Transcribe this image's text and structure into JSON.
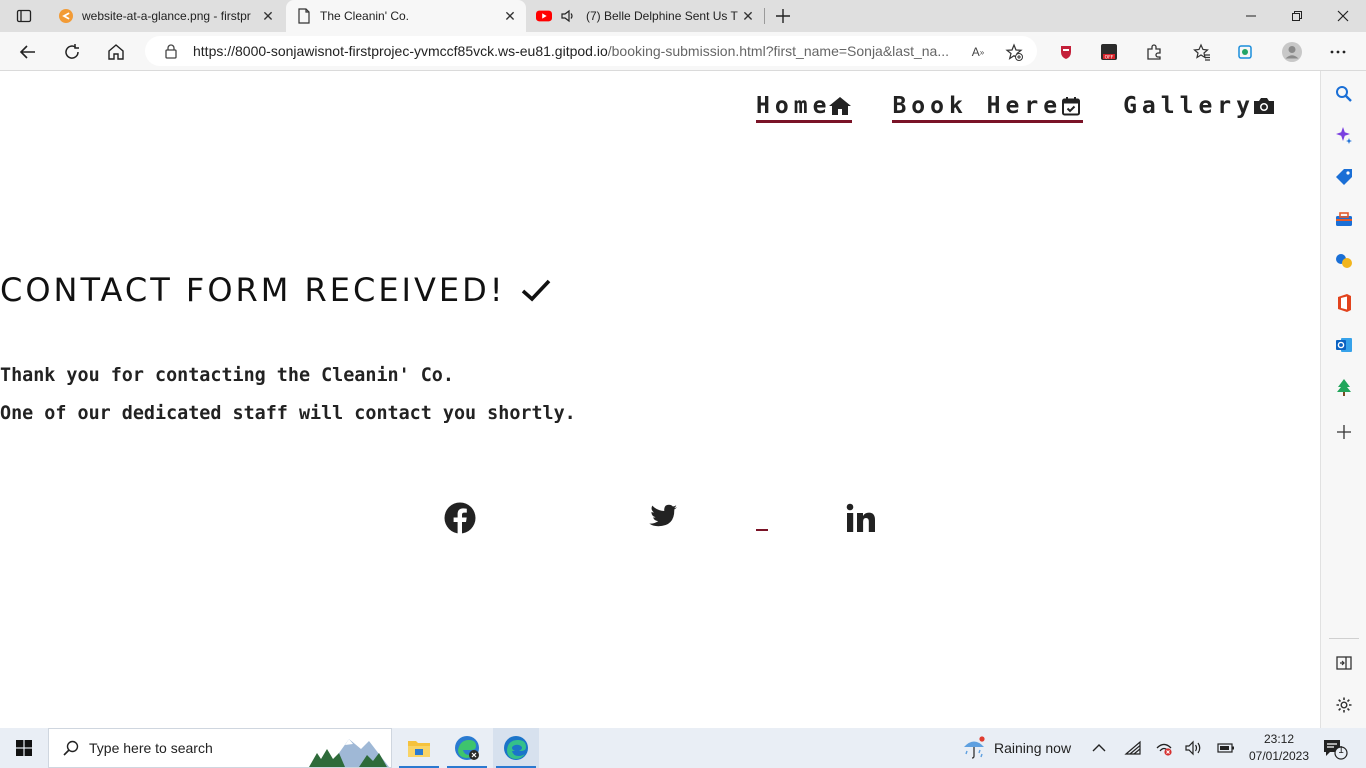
{
  "browser": {
    "tabs": [
      {
        "title": "website-at-a-glance.png - firstpr",
        "favicon": "gitpod-icon",
        "active": false
      },
      {
        "title": "The Cleanin' Co.",
        "favicon": "page-icon",
        "active": true
      },
      {
        "title": "(7) Belle Delphine Sent Us Th",
        "favicon": "youtube-icon",
        "active": false,
        "audio": true
      }
    ],
    "url_host": "https://8000-sonjawisnot-firstprojec-yvmccf85vck.ws-eu81.gitpod.io",
    "url_rest": "/booking-submission.html?first_name=Sonja&last_na..."
  },
  "site": {
    "nav": [
      {
        "label": "Home",
        "icon": "house-icon"
      },
      {
        "label": "Book Here",
        "icon": "calendar-check-icon"
      },
      {
        "label": "Gallery",
        "icon": "camera-icon"
      }
    ],
    "heading": "CONTACT FORM RECEIVED!",
    "message_line_1": "Thank you for contacting the Cleanin' Co.",
    "message_line_2": "One of our dedicated staff will contact you shortly.",
    "social": [
      "facebook-icon",
      "twitter-icon",
      "linkedin-icon"
    ],
    "accent_color": "#7a1327"
  },
  "taskbar": {
    "search_placeholder": "Type here to search",
    "weather": "Raining now",
    "time": "23:12",
    "date": "07/01/2023",
    "notification_count": "1"
  }
}
